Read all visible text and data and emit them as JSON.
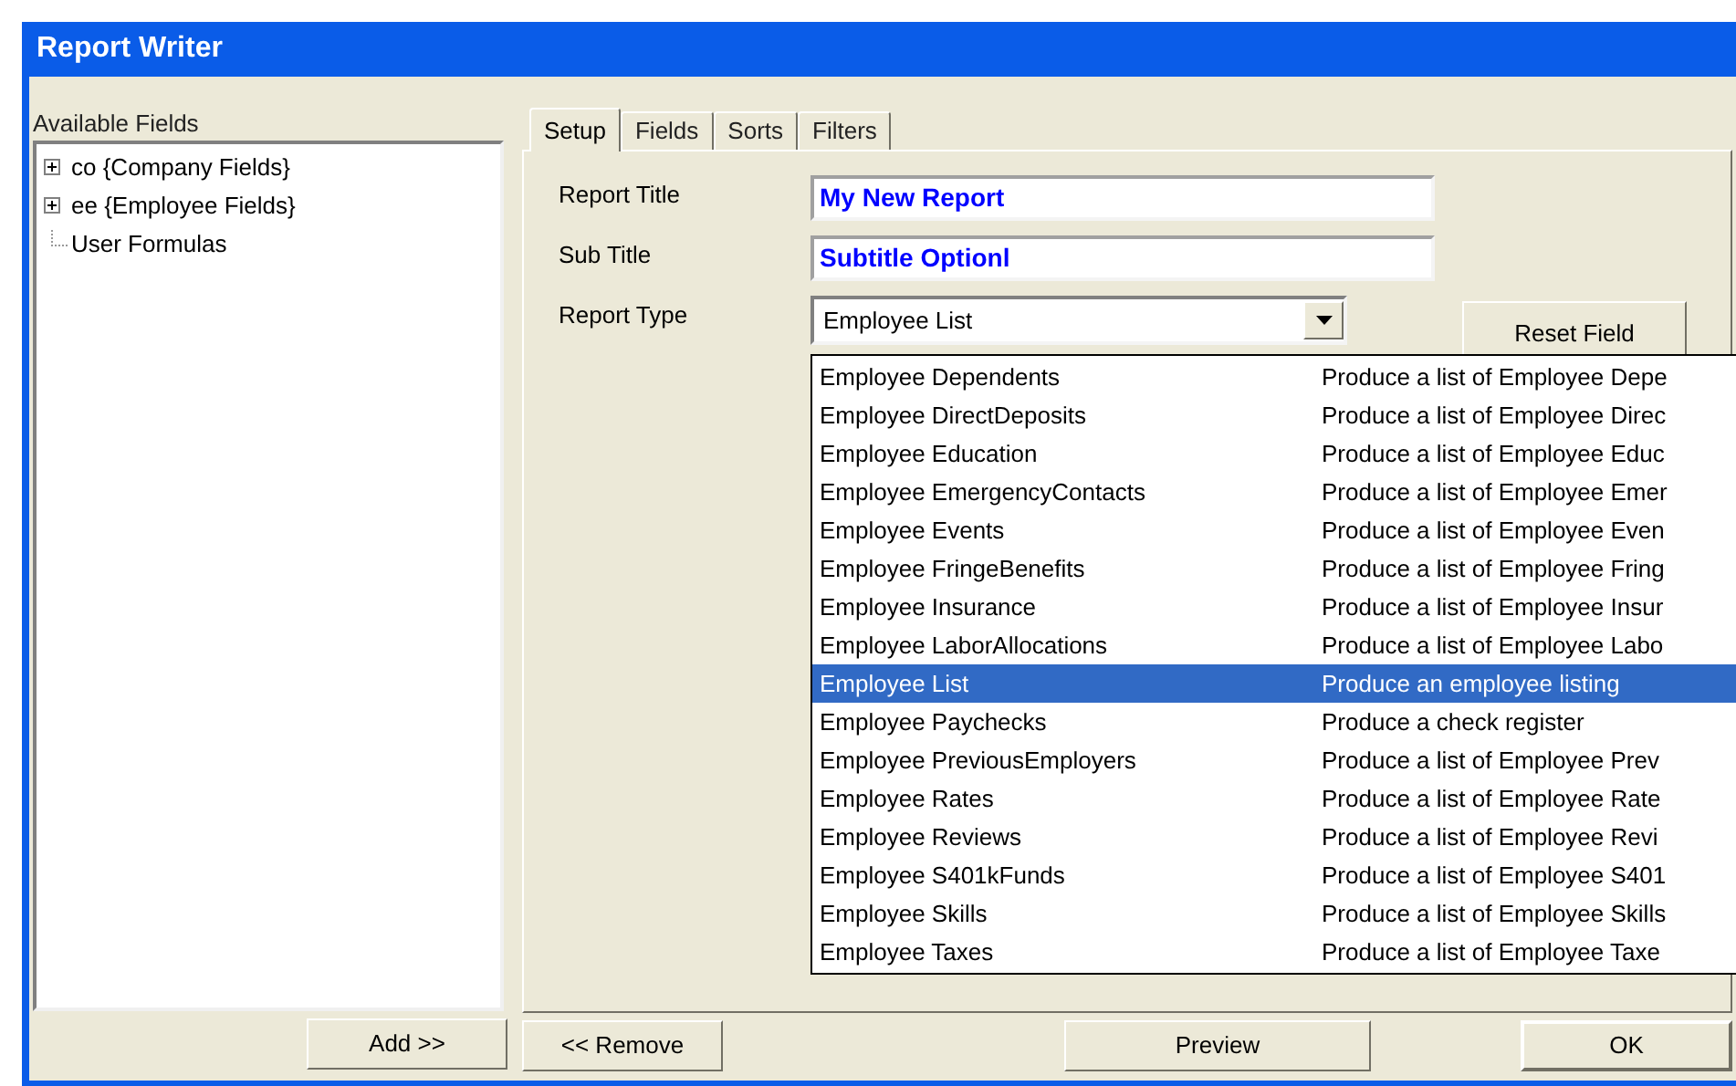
{
  "window": {
    "title": "Report Writer"
  },
  "available_fields": {
    "label": "Available Fields",
    "tree": [
      {
        "label": "co {Company Fields}",
        "expanded": false,
        "has_children": true
      },
      {
        "label": "ee {Employee Fields}",
        "expanded": false,
        "has_children": true
      },
      {
        "label": "User Formulas",
        "has_children": false
      }
    ]
  },
  "tabs": [
    {
      "label": "Setup",
      "selected": true
    },
    {
      "label": "Fields",
      "selected": false
    },
    {
      "label": "Sorts",
      "selected": false
    },
    {
      "label": "Filters",
      "selected": false
    }
  ],
  "form": {
    "report_title_label": "Report Title",
    "report_title": "My New Report",
    "sub_title_label": "Sub Title",
    "sub_title": "Subtitle Optionl",
    "report_type_label": "Report Type",
    "report_type": "Employee List",
    "reset_button": "Reset Field"
  },
  "report_type_options": [
    {
      "name": "Employee Dependents",
      "description": "Produce a list of Employee Depe",
      "selected": false
    },
    {
      "name": "Employee DirectDeposits",
      "description": "Produce a list of Employee Direc",
      "selected": false
    },
    {
      "name": "Employee Education",
      "description": "Produce a list of Employee Educ",
      "selected": false
    },
    {
      "name": "Employee EmergencyContacts",
      "description": "Produce a list of Employee Emer",
      "selected": false
    },
    {
      "name": "Employee Events",
      "description": "Produce a list of Employee Even",
      "selected": false
    },
    {
      "name": "Employee FringeBenefits",
      "description": "Produce a list of Employee Fring",
      "selected": false
    },
    {
      "name": "Employee Insurance",
      "description": "Produce a list of Employee Insur",
      "selected": false
    },
    {
      "name": "Employee LaborAllocations",
      "description": "Produce a list of Employee Labo",
      "selected": false
    },
    {
      "name": "Employee List",
      "description": "Produce an employee listing",
      "selected": true
    },
    {
      "name": "Employee Paychecks",
      "description": "Produce a check register",
      "selected": false
    },
    {
      "name": "Employee PreviousEmployers",
      "description": "Produce a list of Employee Prev",
      "selected": false
    },
    {
      "name": "Employee Rates",
      "description": "Produce a list of Employee Rate",
      "selected": false
    },
    {
      "name": "Employee Reviews",
      "description": "Produce a list of Employee Revi",
      "selected": false
    },
    {
      "name": "Employee S401kFunds",
      "description": "Produce a list of Employee S401",
      "selected": false
    },
    {
      "name": "Employee Skills",
      "description": "Produce a list of Employee Skills",
      "selected": false
    },
    {
      "name": "Employee Taxes",
      "description": "Produce a list of Employee Taxe",
      "selected": false
    }
  ],
  "buttons": {
    "add": "Add >>",
    "remove": "<< Remove",
    "preview": "Preview",
    "ok": "OK"
  }
}
